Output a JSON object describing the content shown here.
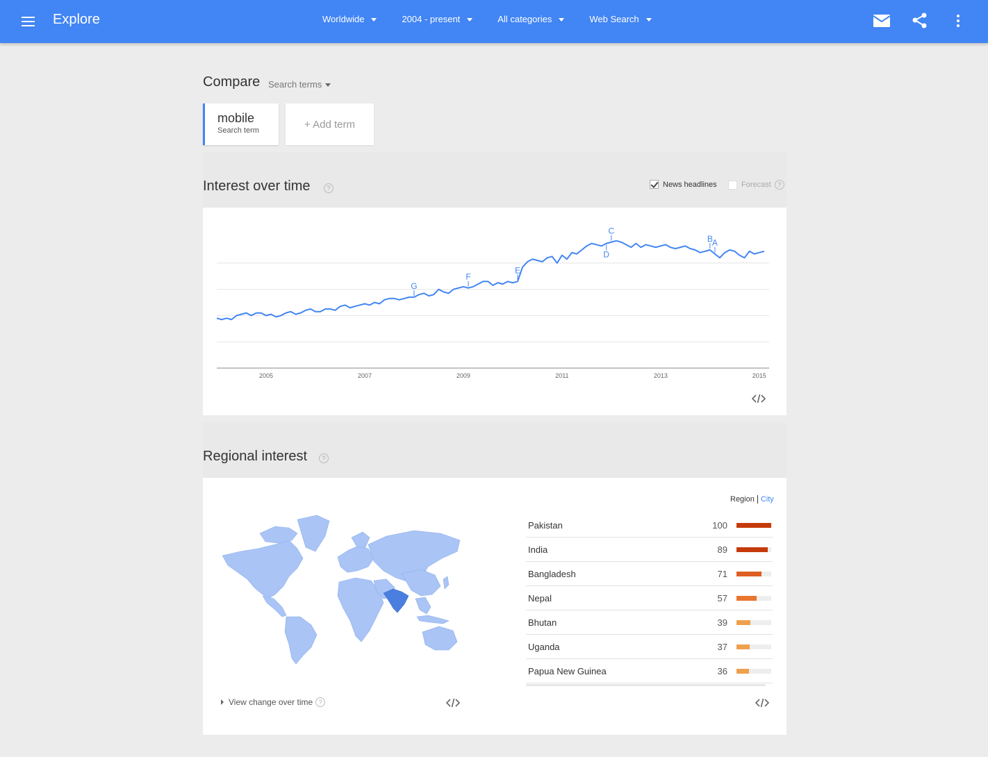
{
  "header": {
    "title": "Explore",
    "filters": [
      {
        "label": "Worldwide"
      },
      {
        "label": "2004 - present"
      },
      {
        "label": "All categories"
      },
      {
        "label": "Web Search"
      }
    ]
  },
  "compare": {
    "title": "Compare",
    "type_label": "Search terms",
    "terms": [
      {
        "term": "mobile",
        "sub": "Search term"
      }
    ],
    "add_label": "+ Add term"
  },
  "interest": {
    "title": "Interest over time",
    "help": "?",
    "news_label": "News headlines",
    "news_checked": true,
    "forecast_label": "Forecast"
  },
  "chart_data": {
    "type": "line",
    "title": "",
    "xlabel": "",
    "ylabel": "",
    "x_ticks": [
      "2005",
      "2007",
      "2009",
      "2011",
      "2013",
      "2015"
    ],
    "x_range": [
      2004.0,
      2015.2
    ],
    "ylim": [
      0,
      100
    ],
    "grid": true,
    "line_color": "#4285f4",
    "series": [
      {
        "x": [
          2004.0,
          2004.1,
          2004.2,
          2004.3,
          2004.4,
          2004.5,
          2004.6,
          2004.7,
          2004.8,
          2004.9,
          2005.0,
          2005.1,
          2005.2,
          2005.3,
          2005.4,
          2005.5,
          2005.6,
          2005.7,
          2005.8,
          2005.9,
          2006.0,
          2006.1,
          2006.2,
          2006.3,
          2006.4,
          2006.5,
          2006.6,
          2006.7,
          2006.8,
          2006.9,
          2007.0,
          2007.1,
          2007.2,
          2007.3,
          2007.4,
          2007.5,
          2007.6,
          2007.7,
          2007.8,
          2007.9,
          2008.0,
          2008.1,
          2008.2,
          2008.3,
          2008.4,
          2008.5,
          2008.6,
          2008.7,
          2008.8,
          2008.9,
          2009.0,
          2009.1,
          2009.2,
          2009.3,
          2009.4,
          2009.5,
          2009.6,
          2009.7,
          2009.8,
          2009.9,
          2010.0,
          2010.1,
          2010.2,
          2010.3,
          2010.4,
          2010.5,
          2010.6,
          2010.7,
          2010.8,
          2010.9,
          2011.0,
          2011.1,
          2011.2,
          2011.3,
          2011.4,
          2011.5,
          2011.6,
          2011.7,
          2011.8,
          2011.9,
          2012.0,
          2012.1,
          2012.2,
          2012.3,
          2012.4,
          2012.5,
          2012.6,
          2012.7,
          2012.8,
          2012.9,
          2013.0,
          2013.1,
          2013.2,
          2013.3,
          2013.4,
          2013.5,
          2013.6,
          2013.7,
          2013.8,
          2013.9,
          2014.0,
          2014.1,
          2014.2,
          2014.3,
          2014.4,
          2014.5,
          2014.6,
          2014.7,
          2014.8,
          2014.9,
          2015.0,
          2015.1
        ],
        "values": [
          38,
          37,
          38,
          37,
          40,
          41,
          42,
          40,
          42,
          42,
          40,
          41,
          39,
          40,
          42,
          43,
          41,
          42,
          44,
          45,
          43,
          43,
          45,
          45,
          44,
          47,
          48,
          46,
          47,
          48,
          49,
          48,
          50,
          49,
          52,
          53,
          53,
          52,
          53,
          54,
          54,
          56,
          57,
          55,
          56,
          60,
          58,
          57,
          60,
          61,
          62,
          61,
          62,
          64,
          66,
          66,
          63,
          65,
          64,
          66,
          65,
          66,
          77,
          81,
          83,
          82,
          81,
          84,
          85,
          80,
          86,
          83,
          88,
          87,
          90,
          93,
          95,
          94,
          93,
          95,
          96,
          97,
          96,
          94,
          92,
          95,
          92,
          94,
          93,
          92,
          93,
          94,
          92,
          91,
          92,
          93,
          91,
          90,
          88,
          89,
          90,
          87,
          84,
          88,
          90,
          89,
          86,
          84,
          89,
          87,
          88,
          89
        ],
        "annotations": [
          {
            "label": "G",
            "x": 2008.0
          },
          {
            "label": "F",
            "x": 2009.1
          },
          {
            "label": "E",
            "x": 2010.1
          },
          {
            "label": "D",
            "x": 2011.9
          },
          {
            "label": "C",
            "x": 2012.0
          },
          {
            "label": "B",
            "x": 2014.0
          },
          {
            "label": "A",
            "x": 2014.1
          }
        ]
      }
    ]
  },
  "regional": {
    "title": "Regional interest",
    "help": "?",
    "toggle": {
      "region": "Region",
      "city": "City"
    },
    "rows": [
      {
        "name": "Pakistan",
        "value": 100,
        "color": "#c53a0b"
      },
      {
        "name": "India",
        "value": 89,
        "color": "#c53a0b"
      },
      {
        "name": "Bangladesh",
        "value": 71,
        "color": "#dd5e22"
      },
      {
        "name": "Nepal",
        "value": 57,
        "color": "#e8762e"
      },
      {
        "name": "Bhutan",
        "value": 39,
        "color": "#eea04f"
      },
      {
        "name": "Uganda",
        "value": 37,
        "color": "#eea04f"
      },
      {
        "name": "Papua New Guinea",
        "value": 36,
        "color": "#eea04f"
      }
    ],
    "view_change": "View change over time",
    "map_highlight_color": "#4a7fe0",
    "map_base_color": "#a9c4f5"
  },
  "icons": {
    "menu": "hamburger-icon",
    "mail": "mail-icon",
    "share": "share-icon",
    "more": "more-vert-icon",
    "embed": "embed-code-icon"
  }
}
